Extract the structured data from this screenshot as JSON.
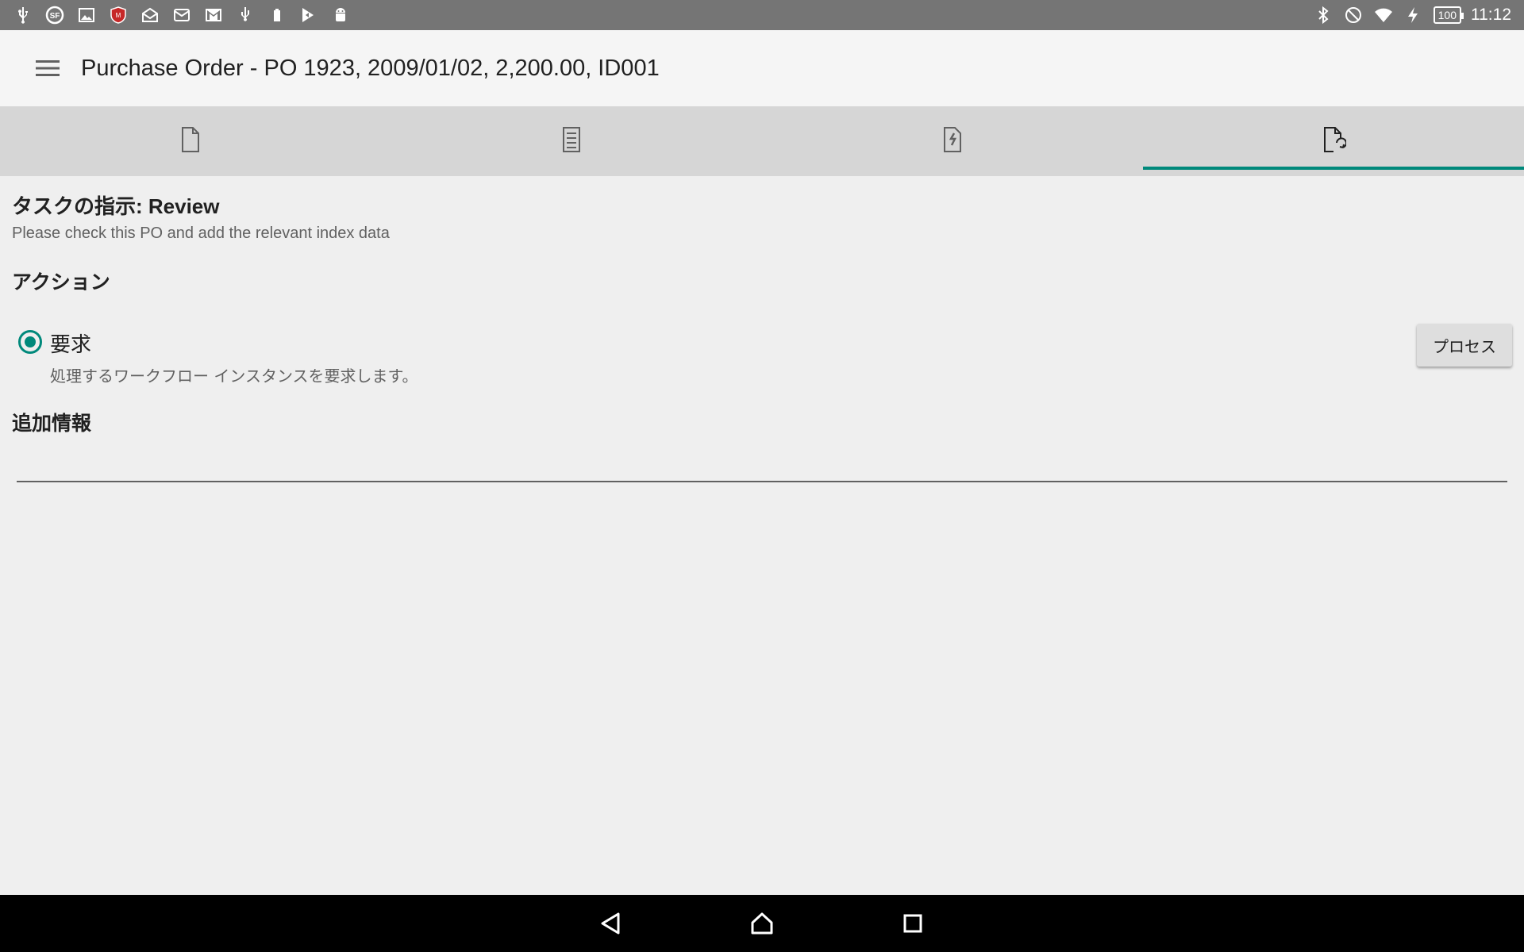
{
  "statusbar": {
    "time": "11:12",
    "battery": "100",
    "left_icons": [
      "usb-icon",
      "sf-app-icon",
      "image-icon",
      "mcafee-icon",
      "mail-open-icon",
      "mail-icon",
      "gmail-icon",
      "usb-debug-icon",
      "battery-charge-icon",
      "play-store-icon",
      "android-icon"
    ],
    "right_icons": [
      "bluetooth-icon",
      "do-not-disturb-icon",
      "wifi-icon",
      "charging-icon"
    ]
  },
  "appbar": {
    "title": "Purchase Order - PO 1923, 2009/01/02, 2,200.00, ID001"
  },
  "tabs": [
    {
      "icon": "document-icon",
      "active": false
    },
    {
      "icon": "checklist-icon",
      "active": false
    },
    {
      "icon": "document-history-icon",
      "active": false
    },
    {
      "icon": "workflow-document-icon",
      "active": true
    }
  ],
  "accent_color": "#00897b",
  "task": {
    "title": "タスクの指示: Review",
    "description": "Please check this PO and add the relevant index data"
  },
  "actions": {
    "heading": "アクション",
    "items": [
      {
        "label": "要求",
        "description": "処理するワークフロー インスタンスを要求します。",
        "selected": true
      }
    ],
    "process_button": "プロセス"
  },
  "additional_info": {
    "heading": "追加情報",
    "value": ""
  }
}
